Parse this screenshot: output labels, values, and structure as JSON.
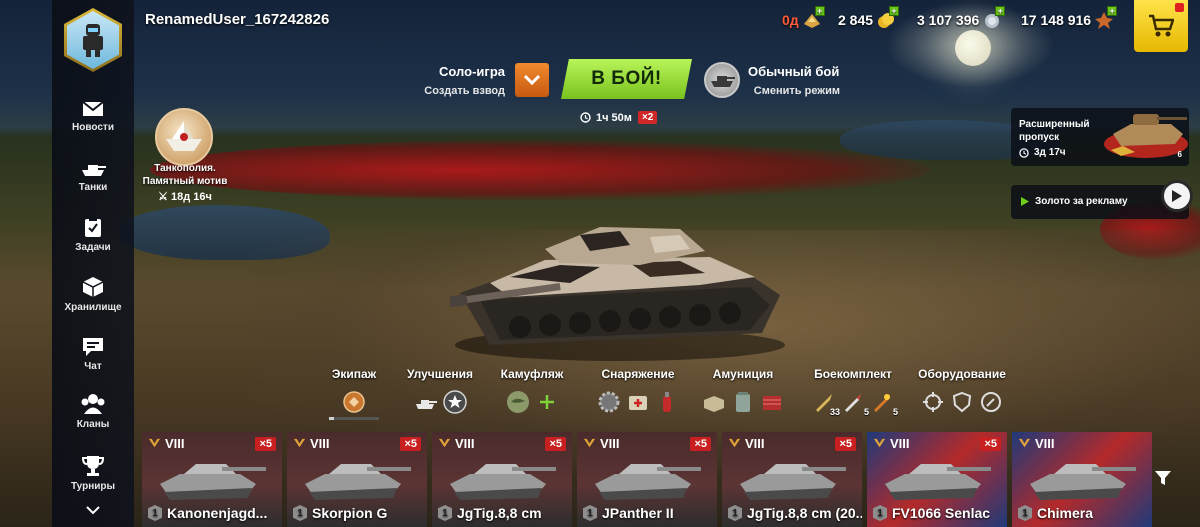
{
  "player": {
    "username": "RenamedUser_167242826"
  },
  "currencies": {
    "premium": {
      "value": "0д",
      "icon": "premium-days-icon"
    },
    "gold": {
      "value": "2 845",
      "icon": "gold-icon"
    },
    "credits": {
      "value": "3 107 396",
      "icon": "credits-icon"
    },
    "free_xp": {
      "value": "17 148 916",
      "icon": "free-xp-icon"
    }
  },
  "nav": [
    {
      "id": "news",
      "label": "Новости",
      "icon": "envelope-icon"
    },
    {
      "id": "tanks",
      "label": "Танки",
      "icon": "tank-icon"
    },
    {
      "id": "tasks",
      "label": "Задачи",
      "icon": "clipboard-icon"
    },
    {
      "id": "storage",
      "label": "Хранилище",
      "icon": "box-icon"
    },
    {
      "id": "chat",
      "label": "Чат",
      "icon": "chat-icon"
    },
    {
      "id": "clans",
      "label": "Кланы",
      "icon": "clan-icon"
    },
    {
      "id": "tournaments",
      "label": "Турниры",
      "icon": "trophy-icon"
    }
  ],
  "battle": {
    "solo_label": "Соло-игра",
    "platoon_label": "Создать взвод",
    "button_label": "В БОЙ!",
    "mode_label": "Обычный бой",
    "change_mode_label": "Сменить режим",
    "timer": "1ч 50м",
    "multiplier": "×2"
  },
  "event": {
    "title_line1": "Танкополия.",
    "title_line2": "Памятный мотив",
    "timer": "18д 16ч"
  },
  "battle_pass": {
    "title_line1": "Расширенный",
    "title_line2": "пропуск",
    "timer": "3д 17ч",
    "level": "6"
  },
  "ad_reward": {
    "label": "Золото за рекламу"
  },
  "equipment": {
    "crew": {
      "label": "Экипаж",
      "progress": 0.1
    },
    "upgrades": {
      "label": "Улучшения"
    },
    "camo": {
      "label": "Камуфляж"
    },
    "gear": {
      "label": "Снаряжение"
    },
    "ammo": {
      "label": "Амуниция"
    },
    "shells": {
      "label": "Боекомплект",
      "counts": [
        "33",
        "5",
        "5"
      ]
    },
    "devices": {
      "label": "Оборудование"
    }
  },
  "carousel": [
    {
      "tier": "VIII",
      "name": "Kanonenjagd...",
      "bonus": "×5",
      "nation": "germany",
      "class": "1"
    },
    {
      "tier": "VIII",
      "name": "Skorpion G",
      "bonus": "×5",
      "nation": "germany",
      "class": "1"
    },
    {
      "tier": "VIII",
      "name": "JgTig.8,8 cm",
      "bonus": "×5",
      "nation": "germany",
      "class": "1"
    },
    {
      "tier": "VIII",
      "name": "JPanther II",
      "bonus": "×5",
      "nation": "germany",
      "class": "1"
    },
    {
      "tier": "VIII",
      "name": "JgTig.8,8 cm (20...",
      "bonus": "×5",
      "nation": "germany",
      "class": "1"
    },
    {
      "tier": "VIII",
      "name": "FV1066 Senlac",
      "bonus": "×5",
      "nation": "uk",
      "class": "1"
    },
    {
      "tier": "VIII",
      "name": "Chimera",
      "bonus": "",
      "nation": "uk",
      "class": "1"
    }
  ],
  "colors": {
    "battle_button": "#8fd62a",
    "platoon_button": "#e0702a",
    "shop_button": "#f5cd1a",
    "bonus_badge": "#c82020",
    "nav_background": "#0e121c"
  }
}
